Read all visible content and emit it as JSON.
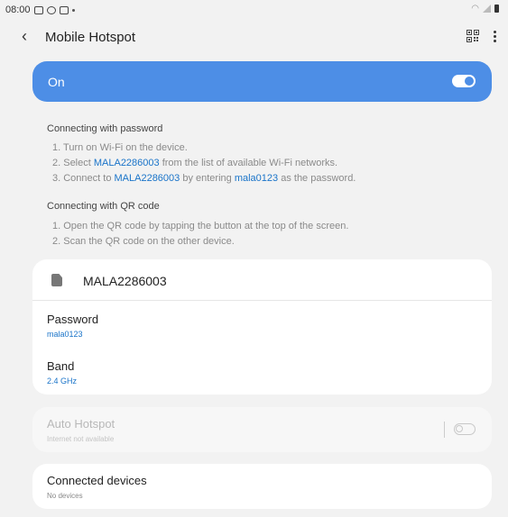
{
  "status_bar": {
    "time": "08:00"
  },
  "app_bar": {
    "title": "Mobile Hotspot"
  },
  "main_switch": {
    "label": "On",
    "state": "on"
  },
  "password_section": {
    "title": "Connecting with password",
    "step1": "1. Turn on Wi-Fi on the device.",
    "step2_prefix": "2. Select ",
    "step2_link": "MALA2286003",
    "step2_suffix": " from the list of available Wi-Fi networks.",
    "step3_prefix": "3. Connect to ",
    "step3_link1": "MALA2286003",
    "step3_mid": " by entering ",
    "step3_link2": "mala0123",
    "step3_suffix": " as the password."
  },
  "qr_section": {
    "title": "Connecting with QR code",
    "step1": "1. Open the QR code by tapping the button at the top of the screen.",
    "step2": "2. Scan the QR code on the other device."
  },
  "network_card": {
    "name": "MALA2286003",
    "password_label": "Password",
    "password_value": "mala0123",
    "band_label": "Band",
    "band_value": "2.4 GHz"
  },
  "auto_hotspot": {
    "title": "Auto Hotspot",
    "subtitle": "Internet not available",
    "state": "off"
  },
  "connected_devices": {
    "title": "Connected devices",
    "subtitle": "No devices"
  },
  "colors": {
    "accent": "#4d8ee6",
    "link": "#1a74c9",
    "background": "#f2f2f2"
  }
}
